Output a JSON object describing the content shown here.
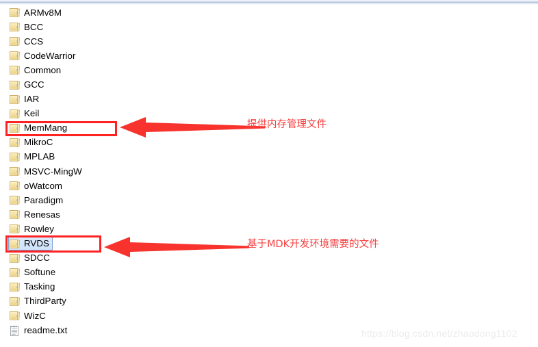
{
  "window": {
    "top_edge_name": "window-chrome-edge"
  },
  "file_list": {
    "items": [
      {
        "name": "ARMv8M",
        "type": "folder",
        "icon": "folder-icon",
        "selected": false
      },
      {
        "name": "BCC",
        "type": "folder",
        "icon": "folder-icon",
        "selected": false
      },
      {
        "name": "CCS",
        "type": "folder",
        "icon": "folder-icon",
        "selected": false
      },
      {
        "name": "CodeWarrior",
        "type": "folder",
        "icon": "folder-icon",
        "selected": false
      },
      {
        "name": "Common",
        "type": "folder",
        "icon": "folder-icon",
        "selected": false
      },
      {
        "name": "GCC",
        "type": "folder",
        "icon": "folder-icon",
        "selected": false
      },
      {
        "name": "IAR",
        "type": "folder",
        "icon": "folder-icon",
        "selected": false
      },
      {
        "name": "Keil",
        "type": "folder",
        "icon": "folder-icon",
        "selected": false
      },
      {
        "name": "MemMang",
        "type": "folder",
        "icon": "folder-icon",
        "selected": false
      },
      {
        "name": "MikroC",
        "type": "folder",
        "icon": "folder-icon",
        "selected": false
      },
      {
        "name": "MPLAB",
        "type": "folder",
        "icon": "folder-icon",
        "selected": false
      },
      {
        "name": "MSVC-MingW",
        "type": "folder",
        "icon": "folder-icon",
        "selected": false
      },
      {
        "name": "oWatcom",
        "type": "folder",
        "icon": "folder-icon",
        "selected": false
      },
      {
        "name": "Paradigm",
        "type": "folder",
        "icon": "folder-icon",
        "selected": false
      },
      {
        "name": "Renesas",
        "type": "folder",
        "icon": "folder-icon",
        "selected": false
      },
      {
        "name": "Rowley",
        "type": "folder",
        "icon": "folder-icon",
        "selected": false
      },
      {
        "name": "RVDS",
        "type": "folder",
        "icon": "folder-icon",
        "selected": true
      },
      {
        "name": "SDCC",
        "type": "folder",
        "icon": "folder-icon",
        "selected": false
      },
      {
        "name": "Softune",
        "type": "folder",
        "icon": "folder-icon",
        "selected": false
      },
      {
        "name": "Tasking",
        "type": "folder",
        "icon": "folder-icon",
        "selected": false
      },
      {
        "name": "ThirdParty",
        "type": "folder",
        "icon": "folder-icon",
        "selected": false
      },
      {
        "name": "WizC",
        "type": "folder",
        "icon": "folder-icon",
        "selected": false
      },
      {
        "name": "readme.txt",
        "type": "file",
        "icon": "text-file-icon",
        "selected": false
      }
    ]
  },
  "annotations": {
    "color": "#f84040",
    "box_color": "#ff2222",
    "memmang": {
      "text": "提供内存管理文件",
      "target": "MemMang"
    },
    "rvds": {
      "text": "基于MDK开发环境需要的文件",
      "target": "RVDS"
    }
  },
  "watermark": {
    "text": "https://blog.csdn.net/zhaodong1102",
    "color": "#ececed"
  }
}
